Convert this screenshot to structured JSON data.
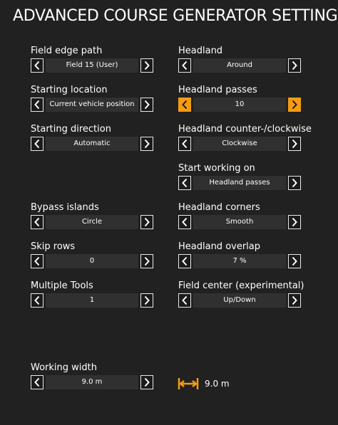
{
  "title": "ADVANCED COURSE GENERATOR SETTINGS",
  "colors": {
    "background": "#212121",
    "value_background": "#303030",
    "accent": "#f39c12",
    "text": "#ffffff"
  },
  "left_settings": {
    "field_edge_path": {
      "label": "Field edge path",
      "value": "Field 15 (User)"
    },
    "starting_location": {
      "label": "Starting location",
      "value": "Current vehicle position"
    },
    "starting_direction": {
      "label": "Starting direction",
      "value": "Automatic"
    },
    "bypass_islands": {
      "label": "Bypass islands",
      "value": "Circle"
    },
    "skip_rows": {
      "label": "Skip rows",
      "value": "0"
    },
    "multiple_tools": {
      "label": "Multiple Tools",
      "value": "1"
    },
    "working_width": {
      "label": "Working width",
      "value": "9.0 m"
    }
  },
  "right_settings": {
    "headland": {
      "label": "Headland",
      "value": "Around"
    },
    "headland_passes": {
      "label": "Headland passes",
      "value": "10"
    },
    "headland_direction": {
      "label": "Headland counter-/clockwise",
      "value": "Clockwise"
    },
    "start_working_on": {
      "label": "Start working on",
      "value": "Headland passes"
    },
    "headland_corners": {
      "label": "Headland corners",
      "value": "Smooth"
    },
    "headland_overlap": {
      "label": "Headland overlap",
      "value": "7 %"
    },
    "field_center": {
      "label": "Field center (experimental)",
      "value": "Up/Down"
    }
  },
  "width_indicator": {
    "icon": "width-arrows-icon",
    "text": "9.0 m"
  },
  "icons": {
    "prev": "chevron-left-icon",
    "next": "chevron-right-icon"
  }
}
